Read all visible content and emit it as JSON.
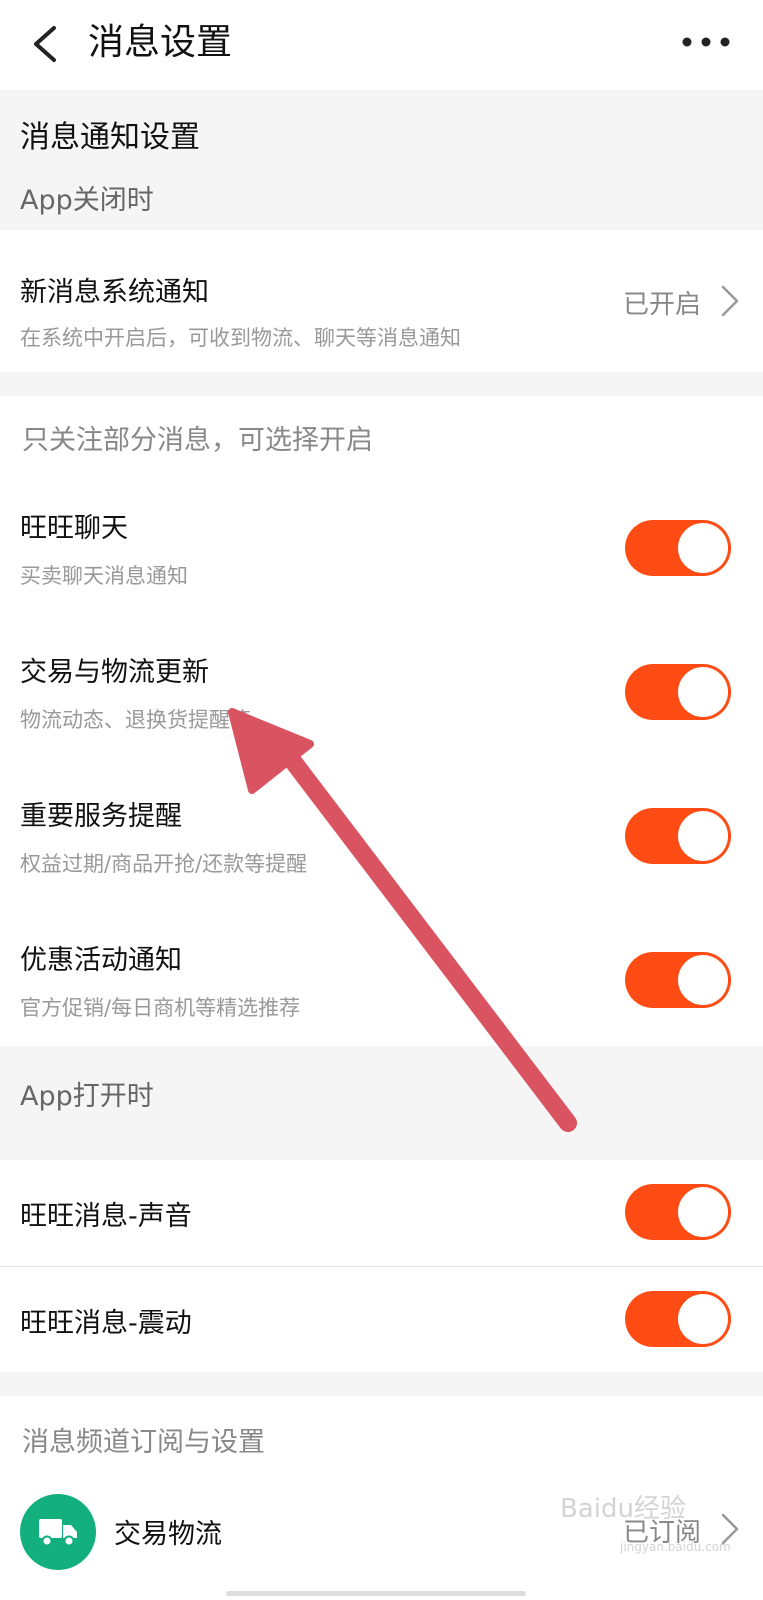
{
  "header": {
    "title": "消息设置",
    "more_icon": "more-horizontal-icon",
    "back_icon": "back-chevron-icon"
  },
  "notification_settings": {
    "title": "消息通知设置",
    "app_closed_label": "App关闭时",
    "system_notice": {
      "title": "新消息系统通知",
      "desc": "在系统中开启后，可收到物流、聊天等消息通知",
      "status": "已开启"
    }
  },
  "partial_group": {
    "label": "只关注部分消息，可选择开启",
    "items": [
      {
        "title": "旺旺聊天",
        "desc": "买卖聊天消息通知",
        "enabled": true
      },
      {
        "title": "交易与物流更新",
        "desc": "物流动态、退换货提醒等",
        "enabled": true
      },
      {
        "title": "重要服务提醒",
        "desc": "权益过期/商品开抢/还款等提醒",
        "enabled": true
      },
      {
        "title": "优惠活动通知",
        "desc": "官方促销/每日商机等精选推荐",
        "enabled": true
      }
    ]
  },
  "app_open": {
    "label": "App打开时",
    "items": [
      {
        "title": "旺旺消息-声音",
        "enabled": true
      },
      {
        "title": "旺旺消息-震动",
        "enabled": true
      }
    ]
  },
  "channels": {
    "label": "消息频道订阅与设置",
    "items": [
      {
        "title": "交易物流",
        "status": "已订阅",
        "icon": "truck-icon"
      }
    ]
  },
  "colors": {
    "toggle_on": "#ff4b14",
    "annotation_arrow": "#d95360",
    "channel_icon_bg": "#13b07e"
  },
  "watermark": {
    "text": "Baidu经验",
    "sub": "jingyan.baidu.com"
  }
}
